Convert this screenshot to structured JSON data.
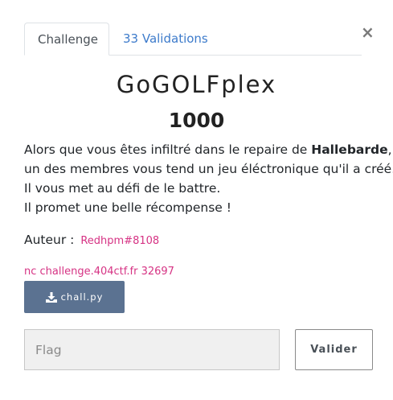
{
  "close_glyph": "×",
  "tabs": {
    "challenge": "Challenge",
    "validations": "33 Validations"
  },
  "challenge": {
    "title": "GoGOLFplex",
    "points": "1000",
    "description": {
      "line1_before": "Alors que vous êtes infiltré dans le repaire de ",
      "line1_bold": "Hallebarde",
      "line1_after": ",",
      "line2": "un des membres vous tend un jeu éléctronique qu'il a créé.",
      "line3": "Il vous met au défi de le battre.",
      "line4": "Il promet une belle récompense !"
    },
    "author_label": "Auteur :",
    "author_name": "Redhpm#8108",
    "connection": "nc challenge.404ctf.fr 32697",
    "file_button": "chall.py"
  },
  "form": {
    "flag_placeholder": "Flag",
    "flag_value": "",
    "submit_label": "Valider"
  },
  "colors": {
    "link": "#3d7bcb",
    "accent_pink": "#d63384",
    "download_button": "#5b7291"
  },
  "icons": {
    "close": "close-icon",
    "download": "download-icon"
  }
}
